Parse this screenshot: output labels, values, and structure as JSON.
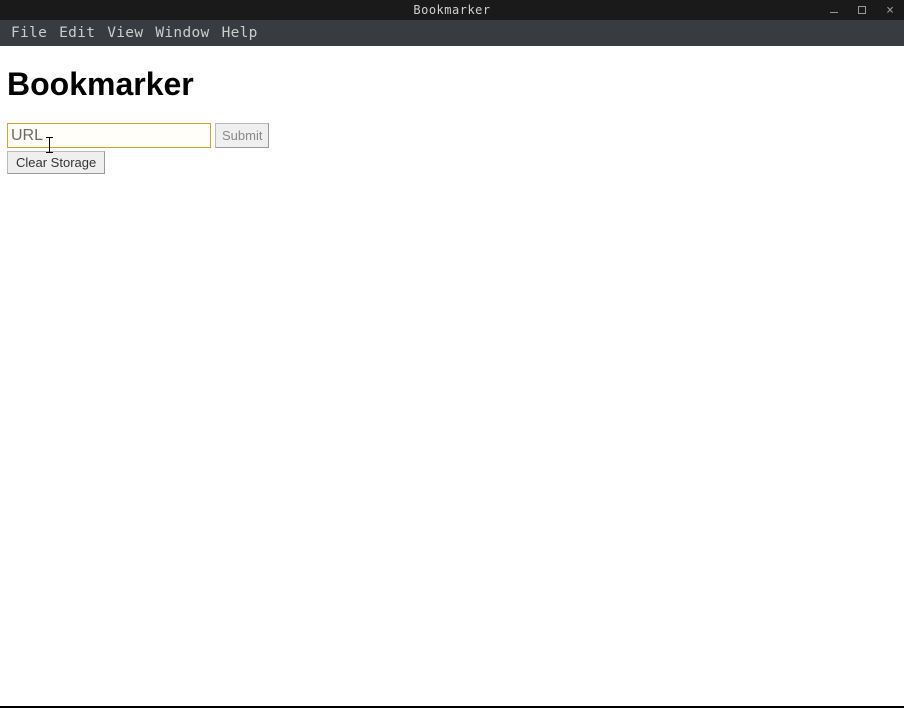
{
  "window": {
    "title": "Bookmarker"
  },
  "menubar": {
    "items": [
      {
        "label": "File"
      },
      {
        "label": "Edit"
      },
      {
        "label": "View"
      },
      {
        "label": "Window"
      },
      {
        "label": "Help"
      }
    ]
  },
  "page": {
    "heading": "Bookmarker",
    "url_placeholder": "URL",
    "url_value": "",
    "submit_label": "Submit",
    "clear_label": "Clear Storage"
  }
}
